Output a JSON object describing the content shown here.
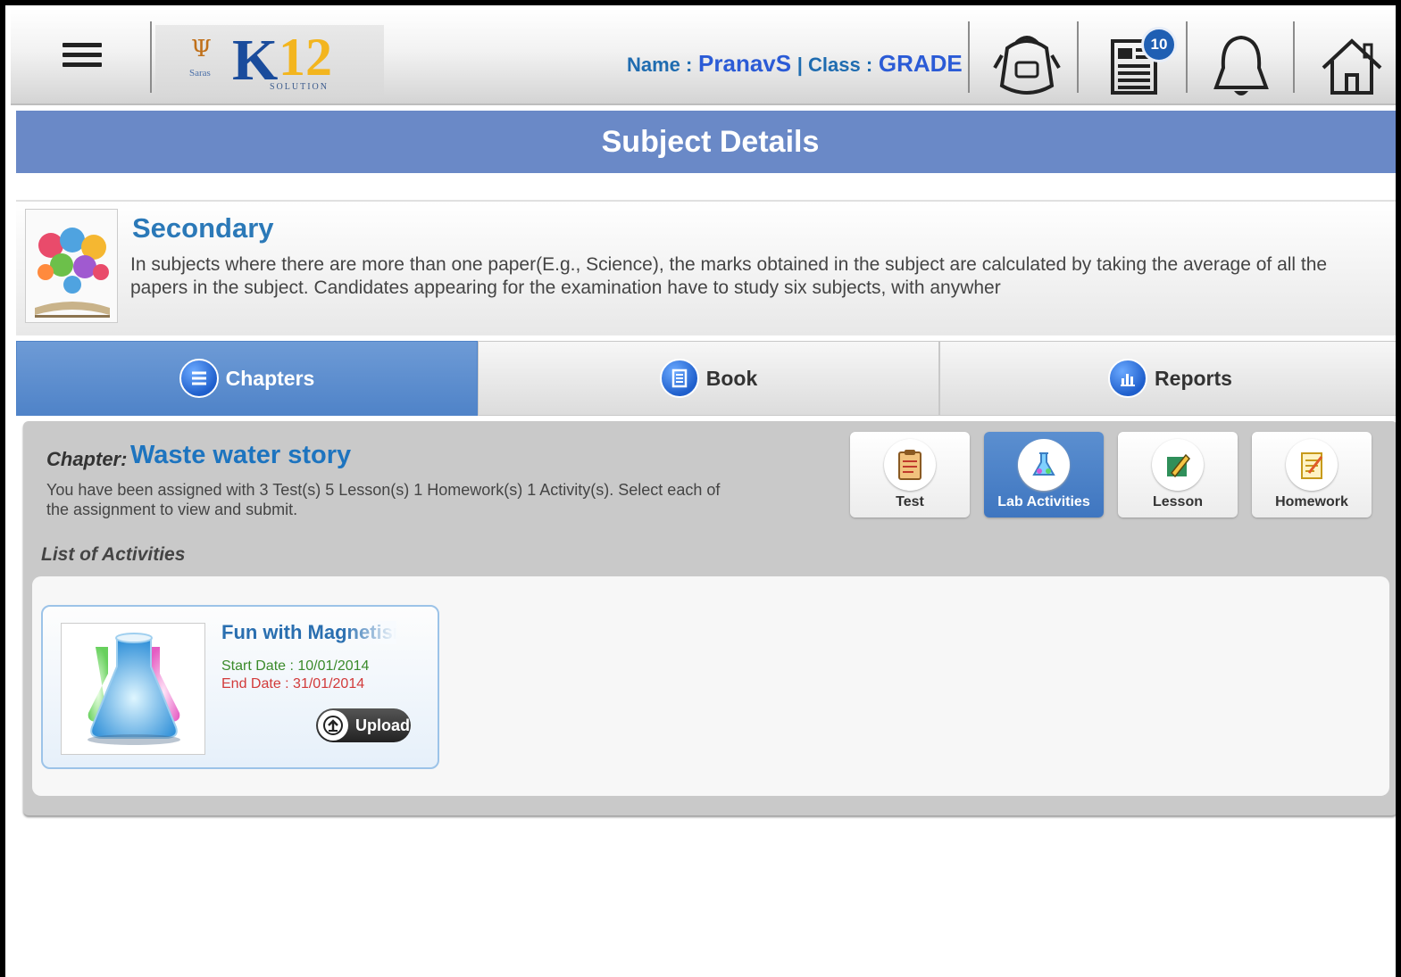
{
  "header": {
    "logo": {
      "top_mark": "Saras",
      "brand": "K12",
      "tagline": "SOLUTION"
    },
    "name_label": "Name :",
    "name_value": "PranavS",
    "class_label": "| Class :",
    "class_value": "GRADE",
    "notification_count": "10",
    "icons": [
      "menu-icon",
      "school-bag-icon",
      "news-icon",
      "bell-icon",
      "home-icon"
    ]
  },
  "page_title": "Subject Details",
  "subject": {
    "title": "Secondary",
    "description": "In subjects where there are more than one paper(E.g., Science), the marks obtained in the subject are calculated by taking the average of all the papers in the subject. Candidates appearing for the examination have to study six subjects, with anywher"
  },
  "tabs": [
    {
      "label": "Chapters",
      "icon": "list-icon",
      "active": true
    },
    {
      "label": "Book",
      "icon": "book-icon",
      "active": false
    },
    {
      "label": "Reports",
      "icon": "bar-chart-icon",
      "active": false
    }
  ],
  "chapter": {
    "label": "Chapter:",
    "name": "Waste water story",
    "description": "You have been assigned with 3 Test(s) 5 Lesson(s) 1 Homework(s) 1 Activity(s). Select each of the assignment to view and submit."
  },
  "activity_types": [
    {
      "label": "Test",
      "icon": "clipboard-icon",
      "active": false
    },
    {
      "label": "Lab Activities",
      "icon": "flask-icon",
      "active": true
    },
    {
      "label": "Lesson",
      "icon": "pencil-icon",
      "active": false
    },
    {
      "label": "Homework",
      "icon": "notepad-icon",
      "active": false
    }
  ],
  "list_label": "List of Activities",
  "activities": [
    {
      "title": "Fun with Magnetism",
      "start": "Start Date : 10/01/2014",
      "end": "End Date : 31/01/2014",
      "upload_label": "Upload"
    }
  ],
  "colors": {
    "title_bar": "#6a89c7",
    "active_tab": "#4f83c8",
    "accent_text": "#1d74bf",
    "start_date": "#3a8a2a",
    "end_date": "#d23a3a"
  }
}
